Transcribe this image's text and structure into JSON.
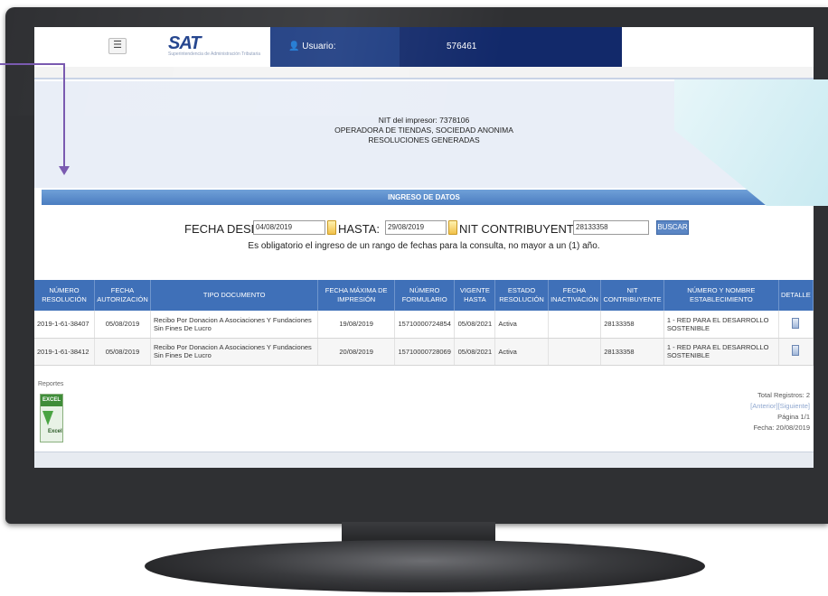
{
  "header": {
    "logo_text": "SAT",
    "logo_sub": "Superintendencia de Administración Tributaria",
    "menu_icon": "☰",
    "user_label": "Usuario:",
    "user_value": "576461"
  },
  "info": {
    "line1": "NIT del impresor: 7378106",
    "line2": "OPERADORA DE TIENDAS, SOCIEDAD ANONIMA",
    "line3": "RESOLUCIONES GENERADAS"
  },
  "section_title": "INGRESO DE DATOS",
  "search": {
    "fecha_desde_label": "FECHA DESDE:",
    "fecha_desde_value": "04/08/2019",
    "hasta_label": "HASTA:",
    "hasta_value": "29/08/2019",
    "nit_label": "NIT CONTRIBUYENTE:",
    "nit_value": "28133358",
    "buscar_label": "BUSCAR",
    "notice": "Es obligatorio el ingreso de un rango de fechas para la consulta, no mayor a un (1) año."
  },
  "table": {
    "headers": [
      "NÚMERO RESOLUCIÓN",
      "FECHA AUTORIZACIÓN",
      "TIPO DOCUMENTO",
      "FECHA MÁXIMA DE IMPRESIÓN",
      "NÚMERO FORMULARIO",
      "VIGENTE HASTA",
      "ESTADO RESOLUCIÓN",
      "FECHA INACTIVACIÓN",
      "NIT CONTRIBUYENTE",
      "NÚMERO Y NOMBRE ESTABLECIMIENTO",
      "DETALLE"
    ],
    "rows": [
      [
        "2019-1-61-38407",
        "05/08/2019",
        "Recibo Por Donacion A Asociaciones Y Fundaciones Sin Fines De Lucro",
        "19/08/2019",
        "15710000724854",
        "05/08/2021",
        "Activa",
        "",
        "28133358",
        "1 - RED PARA EL DESARROLLO SOSTENIBLE"
      ],
      [
        "2019-1-61-38412",
        "05/08/2019",
        "Recibo Por Donacion A Asociaciones Y Fundaciones Sin Fines De Lucro",
        "20/08/2019",
        "15710000728069",
        "05/08/2021",
        "Activa",
        "",
        "28133358",
        "1 - RED PARA EL DESARROLLO SOSTENIBLE"
      ]
    ]
  },
  "footer": {
    "reportes_label": "Reportes",
    "excel_top": "EXCEL",
    "excel_label": "Excel",
    "total": "Total Registros: 2",
    "nav": "[Anterior][Siguiente]",
    "pagina": "Página 1/1",
    "fecha": "Fecha: 20/08/2019"
  }
}
